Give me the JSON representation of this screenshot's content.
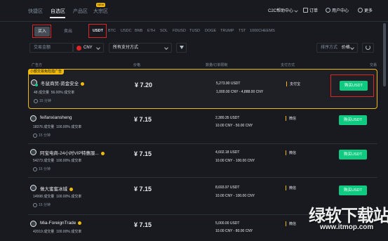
{
  "nav": {
    "tabs": [
      "快捷区",
      "自选区",
      "产品区",
      "大宗区"
    ],
    "active_tab": "自选区",
    "new_badge": "NEW",
    "right": {
      "c2c_help": "C2C帮助中心",
      "orders": "订单",
      "user_center": "用户中心",
      "more": "更多"
    }
  },
  "trade": {
    "buy_label": "买入",
    "sell_label": "卖出",
    "coins": [
      "USDT",
      "BTC",
      "USDC",
      "BNB",
      "ETH",
      "SOL",
      "FDUSD",
      "TUSD",
      "DOGE",
      "TRUMP",
      "TST",
      "1000CHEEMS"
    ],
    "selected_coin": "USDT"
  },
  "filters": {
    "amount_placeholder": "交易金额",
    "currency": "CNY",
    "payment": "所有支付方式",
    "sort_label": "排序方式",
    "sort_value": "价格"
  },
  "table": {
    "headers": {
      "merchant": "广告方",
      "price": "价格",
      "limits": "数量/订单限制",
      "payment": "支付方式",
      "trade": "交易"
    },
    "promo_tag": "小额交易免险措广告",
    "rows": [
      {
        "name": "冬鼠商贸-资金安全",
        "orders": "48 成交量",
        "completion": "56.00% 成交率",
        "time": "15 分钟",
        "price": "¥ 7.20",
        "available": "5,273.90 USDT",
        "limit": "1,000.00 CNY - 4,888.00 CNY",
        "payment": "支付宝",
        "button": "购买USDT"
      },
      {
        "name": "feifanxiansheng",
        "orders": "18376 成交量",
        "completion": "100.00% 成交率",
        "time": "15 分钟",
        "price": "¥ 7.15",
        "available": "2,380.35 USDT",
        "limit": "10.00 CNY - 50.00 CNY",
        "payment": "微信",
        "button": "购买USDT"
      },
      {
        "name": "阿宝电商-24小时VIP特惠服...",
        "orders": "54273 成交量",
        "completion": "100.00% 成交率",
        "time": "15 分钟",
        "price": "¥ 7.15",
        "available": "4,602.18 USDT",
        "limit": "10.00 CNY - 100.00 CNY",
        "payment": "微信",
        "button": "购买USDT"
      },
      {
        "name": "做大蜜蜜冰城",
        "orders": "14998 成交量",
        "completion": "100.00% 成交率",
        "time": "15 分钟",
        "price": "¥ 7.15",
        "available": "8,693.97 USDT",
        "limit": "10.00 CNY - 100.00 CNY",
        "payment": "微信",
        "button": "购买USDT"
      },
      {
        "name": "Mia-ForeignTrade",
        "orders": "42019 成交量",
        "completion": "100.00% 成交率",
        "time": "",
        "price": "¥ 7.15",
        "available": "5,000.00 USDT",
        "limit": "10.00 CNY - 80.00 CNY",
        "payment": "微信",
        "button": "购买USDT"
      }
    ]
  },
  "watermark": {
    "title": "绿软下载站",
    "url": "www.itmop.com"
  },
  "colors": {
    "background": "#181a20",
    "buy_green": "#0ecb81",
    "accent_yellow": "#f0b90b",
    "highlight_red": "#e02424"
  }
}
